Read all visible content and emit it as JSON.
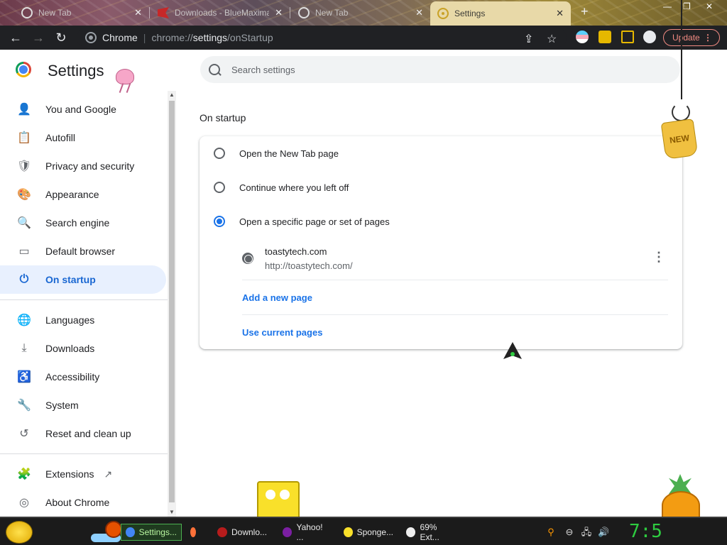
{
  "tabs": [
    {
      "title": "New Tab",
      "icon": "new-tab-icon"
    },
    {
      "title": "Downloads - BlueMaxima",
      "icon": "flashpoint-icon"
    },
    {
      "title": "New Tab",
      "icon": "new-tab-icon"
    },
    {
      "title": "Settings",
      "icon": "settings-gear-icon",
      "active": true
    }
  ],
  "tab_close_glyph": "✕",
  "new_tab_glyph": "+",
  "window": {
    "minimize": "—",
    "maximize": "❐",
    "close": "✕"
  },
  "toolbar": {
    "back": "←",
    "forward": "→",
    "reload": "↻",
    "omnibox": {
      "site_label": "Chrome",
      "separator": "|",
      "url_scheme": "chrome://",
      "url_host": "settings",
      "url_path": "/onStartup"
    },
    "share": "⇪",
    "bookmark": "☆",
    "update_label": "Update",
    "update_menu": "⋮"
  },
  "settings": {
    "title": "Settings",
    "search_placeholder": "Search settings",
    "nav_primary": [
      {
        "label": "You and Google",
        "icon": "person-icon",
        "glyph": "👤"
      },
      {
        "label": "Autofill",
        "icon": "clipboard-icon",
        "glyph": "📋"
      },
      {
        "label": "Privacy and security",
        "icon": "shield-icon",
        "glyph": "🛡"
      },
      {
        "label": "Appearance",
        "icon": "palette-icon",
        "glyph": "🎨"
      },
      {
        "label": "Search engine",
        "icon": "search-icon",
        "glyph": "🔍"
      },
      {
        "label": "Default browser",
        "icon": "browser-window-icon",
        "glyph": "▭"
      },
      {
        "label": "On startup",
        "icon": "power-icon",
        "glyph": "⏻",
        "selected": true
      }
    ],
    "nav_secondary": [
      {
        "label": "Languages",
        "icon": "globe-icon",
        "glyph": "🌐"
      },
      {
        "label": "Downloads",
        "icon": "download-icon",
        "glyph": "⤓"
      },
      {
        "label": "Accessibility",
        "icon": "accessibility-icon",
        "glyph": "♿"
      },
      {
        "label": "System",
        "icon": "wrench-icon",
        "glyph": "🔧"
      },
      {
        "label": "Reset and clean up",
        "icon": "restore-icon",
        "glyph": "↺"
      }
    ],
    "nav_tertiary": [
      {
        "label": "Extensions",
        "icon": "puzzle-icon",
        "glyph": "🧩",
        "external_glyph": "↗"
      },
      {
        "label": "About Chrome",
        "icon": "chrome-icon",
        "glyph": "◎"
      }
    ],
    "section_title": "On startup",
    "options": [
      {
        "label": "Open the New Tab page",
        "checked": false
      },
      {
        "label": "Continue where you left off",
        "checked": false
      },
      {
        "label": "Open a specific page or set of pages",
        "checked": true
      }
    ],
    "startup_page": {
      "name": "toastytech.com",
      "url": "http://toastytech.com/",
      "menu_glyph": "⋮"
    },
    "add_page_label": "Add a new page",
    "use_current_label": "Use current pages"
  },
  "decorations": {
    "new_badge": "NEW"
  },
  "taskbar": {
    "items": [
      {
        "label": "Settings...",
        "icon": "chrome-icon",
        "active": true,
        "color": "#4285f4"
      },
      {
        "label": "",
        "icon": "firefox-icon",
        "color": "#ff7139"
      },
      {
        "label": "Downlo...",
        "icon": "download-app-icon",
        "color": "#b71c1c"
      },
      {
        "label": "Yahoo! ...",
        "icon": "yahoo-icon",
        "color": "#7b1fa2"
      },
      {
        "label": "Sponge...",
        "icon": "spongebob-icon",
        "color": "#f9e02a"
      },
      {
        "label": "69% Ext...",
        "icon": "7zip-icon",
        "color": "#eeeeee"
      }
    ],
    "clock": "7:5"
  },
  "colors": {
    "accent": "#1a73e8",
    "selected_bg": "#e8f0fe",
    "toolbar_bg": "#202124",
    "update": "#f28b82",
    "clock": "#2ecc40"
  }
}
